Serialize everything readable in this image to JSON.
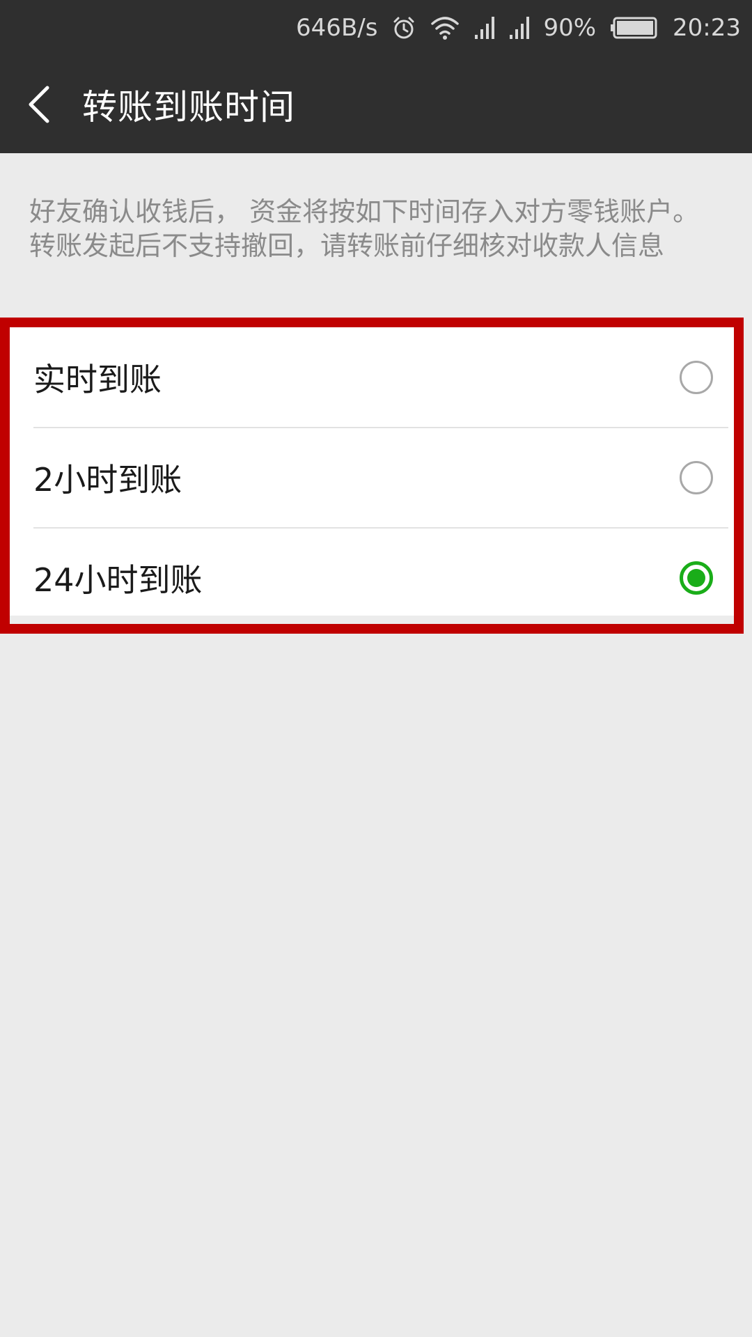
{
  "status_bar": {
    "network_speed": "646B/s",
    "battery_percent": "90%",
    "time": "20:23",
    "icons": [
      "alarm-icon",
      "wifi-icon",
      "signal-icon",
      "signal-icon",
      "battery-icon"
    ]
  },
  "header": {
    "title": "转账到账时间",
    "back_icon": "chevron-left-icon"
  },
  "description": "好友确认收钱后， 资金将按如下时间存入对方零钱账户。转账发起后不支持撤回，请转账前仔细核对收款人信息",
  "options": [
    {
      "label": "实时到账",
      "selected": false
    },
    {
      "label": "2小时到账",
      "selected": false
    },
    {
      "label": "24小时到账",
      "selected": true
    }
  ],
  "colors": {
    "bar_background": "#2f2f2f",
    "page_background": "#ebebeb",
    "highlight_border": "#c00000",
    "radio_selected": "#1aad19"
  }
}
